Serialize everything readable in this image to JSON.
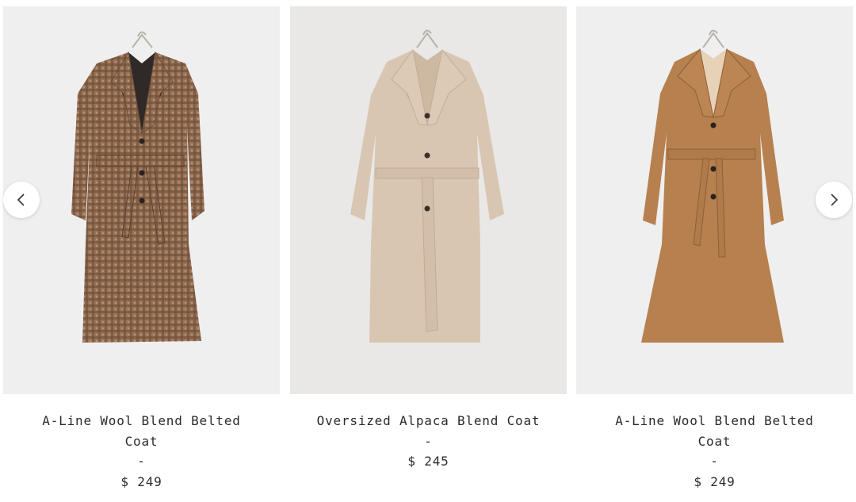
{
  "carousel": {
    "prev_icon": "chevron-left-icon",
    "next_icon": "chevron-right-icon"
  },
  "products": [
    {
      "title": "A-Line Wool Blend Belted Coat",
      "separator": "-",
      "price": "$ 249",
      "image_colors": {
        "background": "#efefef",
        "coat": "#9a7458",
        "accent": "#5a3f2e",
        "pattern": "houndstooth-check"
      }
    },
    {
      "title": "Oversized Alpaca Blend Coat",
      "separator": "-",
      "price": "$ 245",
      "image_colors": {
        "background": "#e9e8e7",
        "coat": "#d9c6b2",
        "accent": "#b9a590",
        "pattern": "solid"
      }
    },
    {
      "title": "A-Line Wool Blend Belted Coat",
      "separator": "-",
      "price": "$ 249",
      "image_colors": {
        "background": "#efefef",
        "coat": "#b7804f",
        "accent": "#8f5f37",
        "pattern": "solid"
      }
    }
  ]
}
